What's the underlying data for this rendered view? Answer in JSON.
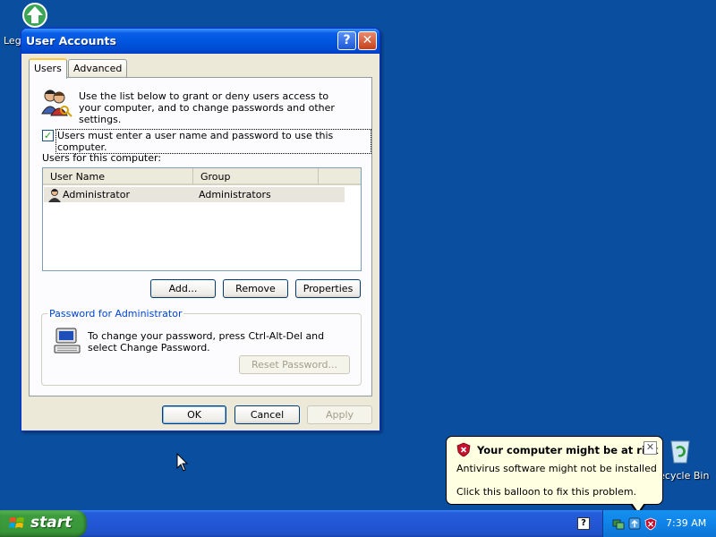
{
  "desktop": {
    "icon_top_label": "Leg",
    "recycle_bin_label": "Recycle Bin"
  },
  "window": {
    "title": "User Accounts",
    "help_glyph": "?",
    "close_glyph": "✕",
    "tabs": [
      {
        "label": "Users",
        "selected": true
      },
      {
        "label": "Advanced",
        "selected": false
      }
    ],
    "intro_text": "Use the list below to grant or deny users access to your computer, and to change passwords and other settings.",
    "checkbox": {
      "label": "Users must enter a user name and password to use this computer.",
      "checked": true,
      "mark": "✓"
    },
    "users_heading": "Users for this computer:",
    "list": {
      "columns": [
        "User Name",
        "Group"
      ],
      "rows": [
        {
          "user_name": "Administrator",
          "group": "Administrators"
        }
      ]
    },
    "buttons": {
      "add": "Add...",
      "remove": "Remove",
      "properties": "Properties"
    },
    "password_group": {
      "legend": "Password for Administrator",
      "text": "To change your password, press Ctrl-Alt-Del and select Change Password.",
      "reset_button": "Reset Password..."
    },
    "footer": {
      "ok": "OK",
      "cancel": "Cancel",
      "apply": "Apply"
    }
  },
  "taskbar": {
    "start_label": "start",
    "clock": "7:39 AM"
  },
  "balloon": {
    "title": "Your computer might be at risk",
    "line1": "Antivirus software might not be installed",
    "line2": "Click this balloon to fix this problem.",
    "close_glyph": "✕"
  },
  "colors": {
    "desktop": "#0a4ea0",
    "titlebar": "#0056e0",
    "window_bg": "#ece9d8",
    "balloon_bg": "#ffffe1"
  }
}
